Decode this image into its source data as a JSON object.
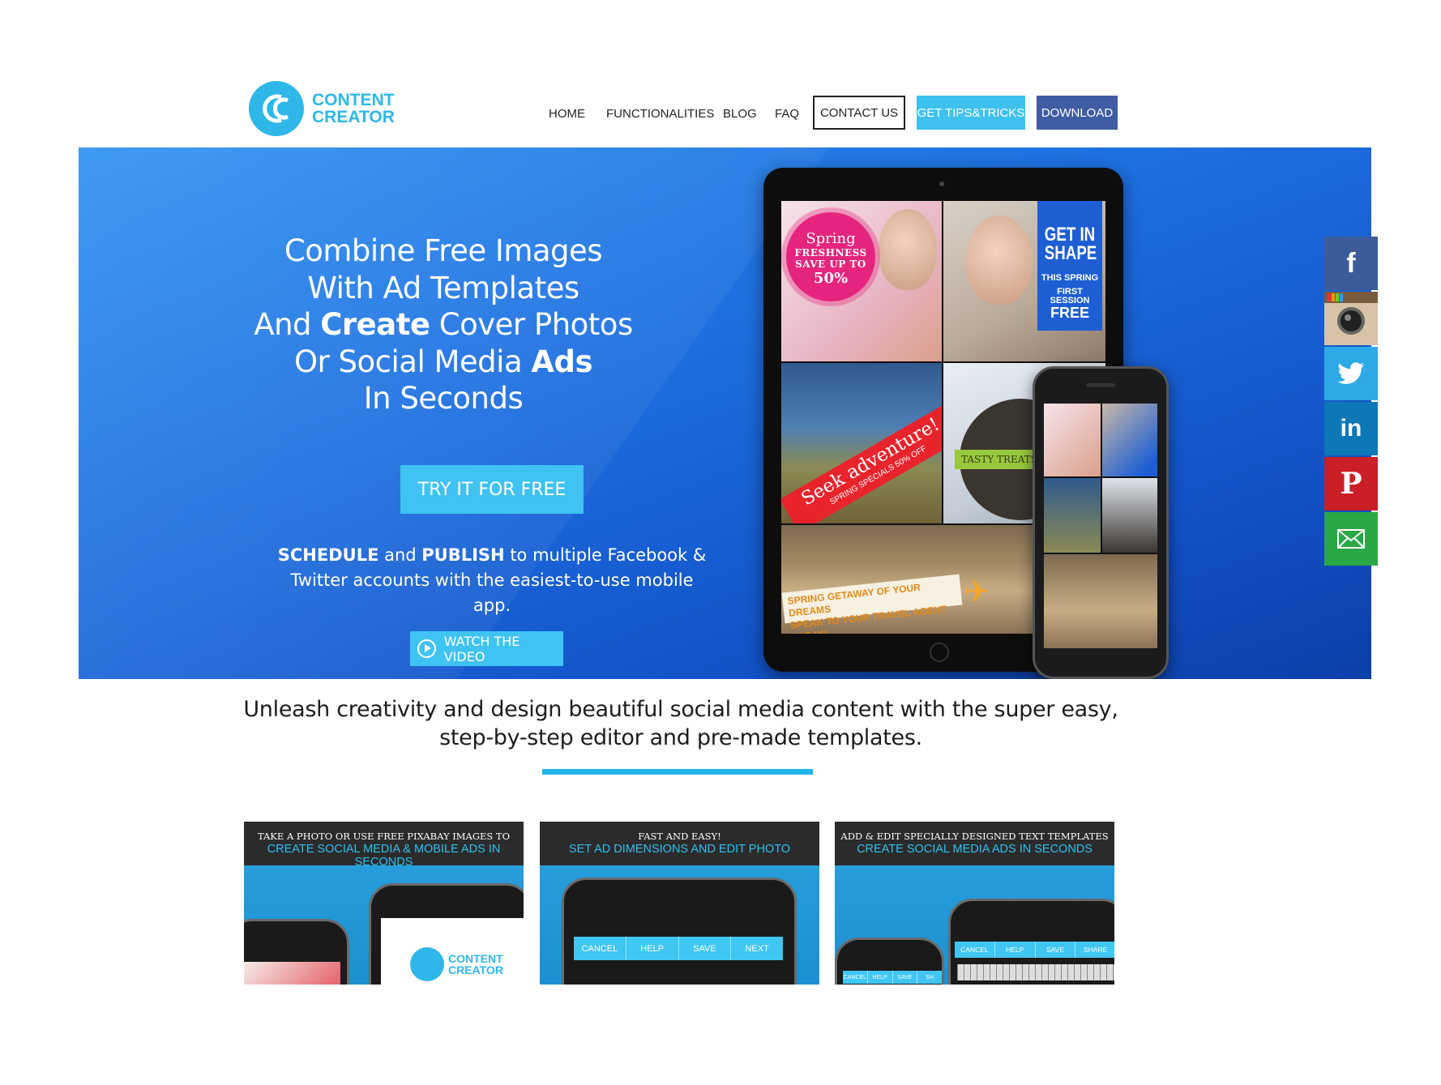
{
  "brand": {
    "line1": "CONTENT",
    "line2": "CREATOR",
    "color": "#30b7ea"
  },
  "nav": {
    "home": "HOME",
    "functionalities": "FUNCTIONALITIES",
    "blog": "BLOG",
    "faq": "FAQ",
    "contact": "CONTACT US",
    "tips": "GET TIPS&TRICKS",
    "download": "DOWNLOAD"
  },
  "hero": {
    "line1": "Combine Free Images",
    "line2": "With Ad Templates",
    "line3_pre": "And ",
    "line3_bold": "Create",
    "line3_post": " Cover Photos",
    "line4_pre": "Or Social Media ",
    "line4_bold": "Ads",
    "line5": "In Seconds",
    "cta": "TRY IT FOR FREE",
    "schedule_bold": "SCHEDULE",
    "schedule_and": " and ",
    "publish_bold": "PUBLISH",
    "schedule_rest": " to multiple Facebook & Twitter accounts with the easiest-to-use mobile app.",
    "video": "WATCH THE VIDEO"
  },
  "mockup": {
    "spring_1": "Spring",
    "spring_2": "FRESHNESS",
    "spring_3": "SAVE UP TO",
    "spring_4": "50%",
    "shape_1": "GET IN SHAPE",
    "shape_2": "THIS SPRING",
    "shape_3": "FIRST SESSION",
    "shape_4": "FREE",
    "seek_1": "Seek adventure!",
    "seek_2": "SPRING SPECIALS 50% OFF",
    "garden": "TASTY TREATS",
    "travel_1": "SPRING GETAWAY OF YOUR DREAMS",
    "travel_2": "SPEAK TO YOUR TRAVEL AGENT TODAY!"
  },
  "social": [
    "facebook-icon",
    "instagram-icon",
    "twitter-icon",
    "linkedin-icon",
    "pinterest-icon",
    "email-icon"
  ],
  "tagline": {
    "line1": "Unleash creativity and design beautiful social media content with the super easy,",
    "line2": "step-by-step editor and pre-made templates."
  },
  "cards": [
    {
      "l1": "TAKE A PHOTO OR USE FREE PIXABAY IMAGES TO",
      "l2": "CREATE SOCIAL MEDIA & MOBILE ADS IN SECONDS"
    },
    {
      "l1": "FAST AND EASY!",
      "l2": "SET AD DIMENSIONS AND EDIT PHOTO",
      "toolbar": [
        "CANCEL",
        "HELP",
        "SAVE",
        "NEXT"
      ]
    },
    {
      "l1": "ADD & EDIT SPECIALLY DESIGNED TEXT TEMPLATES",
      "l2": "CREATE SOCIAL MEDIA ADS IN SECONDS",
      "toolbar": [
        "CANCEL",
        "HELP",
        "SAVE",
        "SHARE"
      ]
    }
  ],
  "colors": {
    "accent": "#3ec1ef",
    "download": "#3f5da3",
    "hero": "#1e6fe0"
  }
}
